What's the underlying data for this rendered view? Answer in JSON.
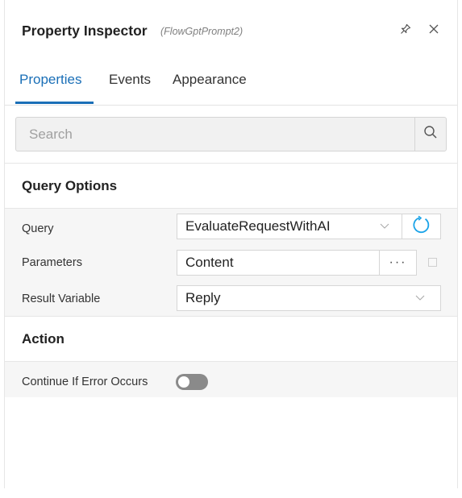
{
  "header": {
    "title": "Property Inspector",
    "subtitle": "(FlowGptPrompt2)",
    "pin_icon": "pin-icon",
    "close_icon": "close-icon"
  },
  "tabs": [
    {
      "label": "Properties",
      "active": true
    },
    {
      "label": "Events",
      "active": false
    },
    {
      "label": "Appearance",
      "active": false
    }
  ],
  "search": {
    "placeholder": "Search",
    "value": ""
  },
  "sections": {
    "query_options": {
      "title": "Query Options",
      "query": {
        "label": "Query",
        "value": "EvaluateRequestWithAI"
      },
      "parameters": {
        "label": "Parameters",
        "value": "Content",
        "button": "···"
      },
      "result_variable": {
        "label": "Result Variable",
        "value": "Reply"
      }
    },
    "action": {
      "title": "Action",
      "continue_if_error": {
        "label": "Continue If Error Occurs",
        "enabled": false
      }
    }
  },
  "colors": {
    "accent": "#1a6fb7",
    "toggle_off": "#8a8a8a",
    "group_bg": "#f6f6f6"
  }
}
